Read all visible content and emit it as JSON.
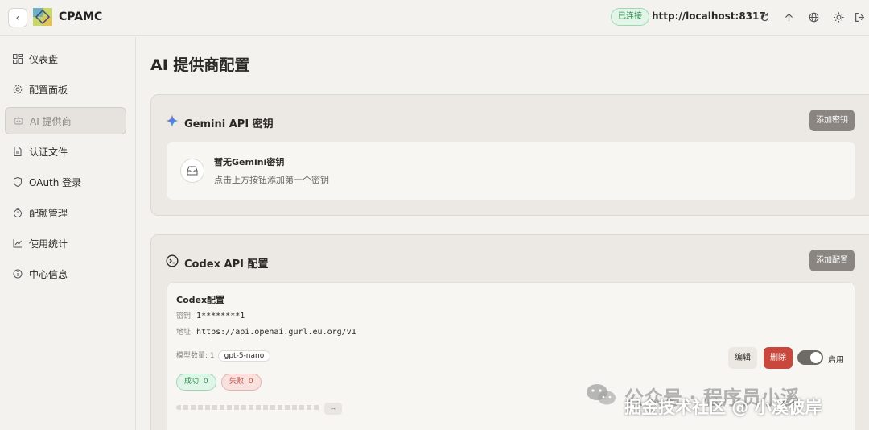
{
  "header": {
    "app_title": "CPAMC",
    "status": "已连接",
    "server_url": "http://localhost:8317",
    "icons": [
      "refresh-icon",
      "upload-icon",
      "globe-icon",
      "sun-icon",
      "logout-icon"
    ]
  },
  "sidebar": {
    "items": [
      {
        "label": "仪表盘",
        "icon": "dashboard-icon"
      },
      {
        "label": "配置面板",
        "icon": "gear-icon"
      },
      {
        "label": "AI 提供商",
        "icon": "bot-icon",
        "active": true
      },
      {
        "label": "认证文件",
        "icon": "file-icon"
      },
      {
        "label": "OAuth 登录",
        "icon": "shield-icon"
      },
      {
        "label": "配额管理",
        "icon": "timer-icon"
      },
      {
        "label": "使用统计",
        "icon": "chart-icon"
      },
      {
        "label": "中心信息",
        "icon": "info-icon"
      }
    ]
  },
  "main": {
    "title": "AI 提供商配置",
    "gemini": {
      "title": "Gemini API 密钥",
      "add_label": "添加密钥",
      "empty_title": "暂无Gemini密钥",
      "empty_desc": "点击上方按钮添加第一个密钥"
    },
    "codex": {
      "title": "Codex API 配置",
      "add_label": "添加配置",
      "config": {
        "name": "Codex配置",
        "key_label": "密钥:",
        "key_value": "1********1",
        "url_label": "地址:",
        "url_value": "https://api.openai.gurl.eu.org/v1",
        "models_label": "模型数量: 1",
        "model_chip": "gpt-5-nano",
        "success": "成功: 0",
        "failure": "失败: 0",
        "edit_label": "编辑",
        "delete_label": "删除",
        "enable_label": "启用",
        "enabled": true,
        "dash": "--"
      }
    }
  },
  "watermark": {
    "line1": "公众号 · 程序员小溪",
    "line2": "掘金技术社区 @ 小溪彼岸"
  }
}
